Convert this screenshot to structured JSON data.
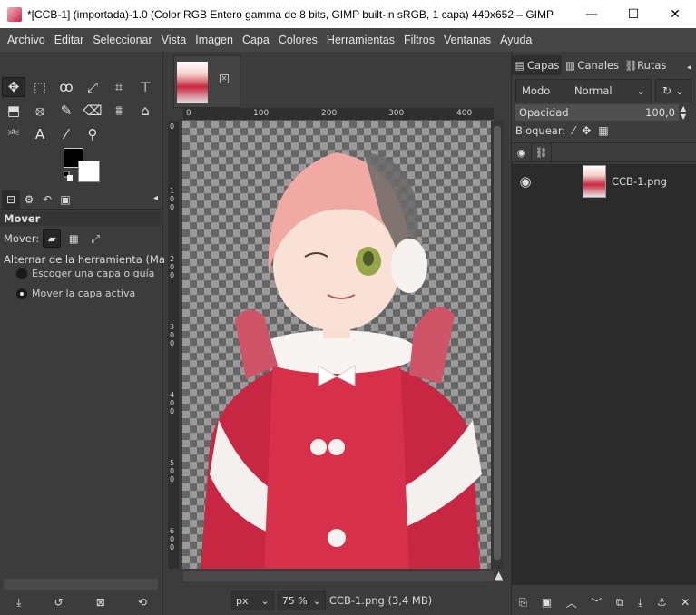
{
  "window": {
    "title": "*[CCB-1] (importada)-1.0 (Color RGB Entero gamma de 8 bits, GIMP built-in sRGB, 1 capa) 449x652 – GIMP",
    "minimize": "—",
    "maximize": "☐",
    "close": "✕"
  },
  "menu": [
    "Archivo",
    "Editar",
    "Seleccionar",
    "Vista",
    "Imagen",
    "Capa",
    "Colores",
    "Herramientas",
    "Filtros",
    "Ventanas",
    "Ayuda"
  ],
  "tools": {
    "row1": [
      "✥",
      "⬚",
      "ꝏ",
      "⤢",
      "⌗",
      "⊤"
    ],
    "row2": [
      "⬒",
      "⦻",
      "✎",
      "⌫",
      "⩩",
      "⌂"
    ],
    "row3": [
      "⎃",
      "A",
      "⁄",
      "⚲"
    ]
  },
  "tool_options": {
    "header": "Mover",
    "mover_label": "Mover:",
    "toggle_label": "Alternar de la herramienta  (Mayús)",
    "option1": "Escoger una capa o guía",
    "option2": "Mover la capa activa"
  },
  "image": {
    "h_ruler": [
      "0",
      "100",
      "200",
      "300",
      "400"
    ],
    "v_ruler": [
      "0",
      "1 0 0",
      "2 0 0",
      "3 0 0",
      "4 0 0",
      "5 0 0",
      "6 0 0"
    ],
    "unit": "px",
    "zoom": "75 %",
    "status": "CCB-1.png (3,4 MB)"
  },
  "right": {
    "tabs": [
      "Capas",
      "Canales",
      "Rutas"
    ],
    "mode_label": "Modo",
    "mode_value": "Normal",
    "opacity_label": "Opacidad",
    "opacity_value": "100,0",
    "lock_label": "Bloquear:",
    "layer_name": "CCB-1.png"
  }
}
